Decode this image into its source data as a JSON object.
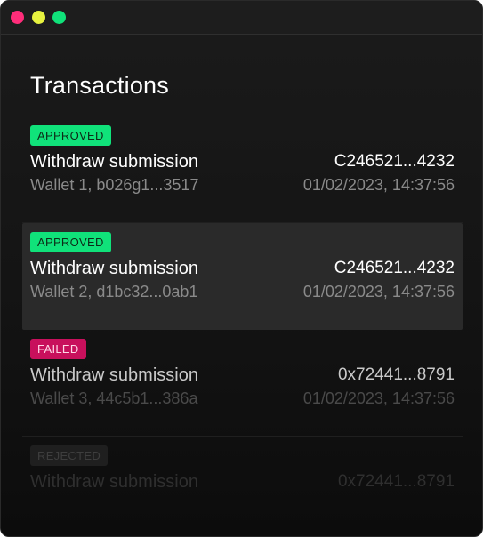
{
  "page": {
    "title": "Transactions"
  },
  "window_controls": [
    "close",
    "minimize",
    "maximize"
  ],
  "colors": {
    "approved": "#10e27a",
    "failed": "#c8105c",
    "rejected": "#1f1f1f",
    "close_dot": "#ff2d7a",
    "minimize_dot": "#e7f23f",
    "maximize_dot": "#10e27a"
  },
  "transactions": [
    {
      "status": "APPROVED",
      "title": "Withdraw submission",
      "reference": "C246521...4232",
      "wallet": "Wallet 1, b026g1...3517",
      "timestamp": "01/02/2023, 14:37:56"
    },
    {
      "status": "APPROVED",
      "title": "Withdraw submission",
      "reference": "C246521...4232",
      "wallet": "Wallet 2, d1bc32...0ab1",
      "timestamp": "01/02/2023, 14:37:56"
    },
    {
      "status": "FAILED",
      "title": "Withdraw submission",
      "reference": "0x72441...8791",
      "wallet": "Wallet 3, 44c5b1...386a",
      "timestamp": "01/02/2023, 14:37:56"
    },
    {
      "status": "REJECTED",
      "title": "Withdraw submission",
      "reference": "0x72441...8791"
    }
  ]
}
